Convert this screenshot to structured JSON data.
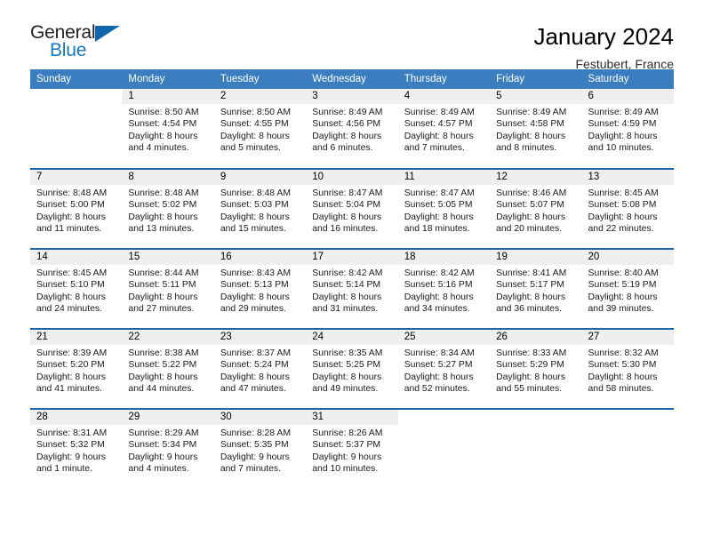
{
  "brand": {
    "name_top": "General",
    "name_bottom": "Blue",
    "triangle_color": "#1166ad",
    "text_color": "#231f20",
    "accent_color": "#1878be"
  },
  "header": {
    "title": "January 2024",
    "subtitle": "Festubert, France"
  },
  "theme": {
    "header_bg": "#3a7ebf",
    "row_divider": "#1f63a8",
    "daynum_bg": "#efefef"
  },
  "weekdays": [
    "Sunday",
    "Monday",
    "Tuesday",
    "Wednesday",
    "Thursday",
    "Friday",
    "Saturday"
  ],
  "weeks": [
    [
      {
        "day": "",
        "lines": []
      },
      {
        "day": "1",
        "lines": [
          "Sunrise: 8:50 AM",
          "Sunset: 4:54 PM",
          "Daylight: 8 hours",
          "and 4 minutes."
        ]
      },
      {
        "day": "2",
        "lines": [
          "Sunrise: 8:50 AM",
          "Sunset: 4:55 PM",
          "Daylight: 8 hours",
          "and 5 minutes."
        ]
      },
      {
        "day": "3",
        "lines": [
          "Sunrise: 8:49 AM",
          "Sunset: 4:56 PM",
          "Daylight: 8 hours",
          "and 6 minutes."
        ]
      },
      {
        "day": "4",
        "lines": [
          "Sunrise: 8:49 AM",
          "Sunset: 4:57 PM",
          "Daylight: 8 hours",
          "and 7 minutes."
        ]
      },
      {
        "day": "5",
        "lines": [
          "Sunrise: 8:49 AM",
          "Sunset: 4:58 PM",
          "Daylight: 8 hours",
          "and 8 minutes."
        ]
      },
      {
        "day": "6",
        "lines": [
          "Sunrise: 8:49 AM",
          "Sunset: 4:59 PM",
          "Daylight: 8 hours",
          "and 10 minutes."
        ]
      }
    ],
    [
      {
        "day": "7",
        "lines": [
          "Sunrise: 8:48 AM",
          "Sunset: 5:00 PM",
          "Daylight: 8 hours",
          "and 11 minutes."
        ]
      },
      {
        "day": "8",
        "lines": [
          "Sunrise: 8:48 AM",
          "Sunset: 5:02 PM",
          "Daylight: 8 hours",
          "and 13 minutes."
        ]
      },
      {
        "day": "9",
        "lines": [
          "Sunrise: 8:48 AM",
          "Sunset: 5:03 PM",
          "Daylight: 8 hours",
          "and 15 minutes."
        ]
      },
      {
        "day": "10",
        "lines": [
          "Sunrise: 8:47 AM",
          "Sunset: 5:04 PM",
          "Daylight: 8 hours",
          "and 16 minutes."
        ]
      },
      {
        "day": "11",
        "lines": [
          "Sunrise: 8:47 AM",
          "Sunset: 5:05 PM",
          "Daylight: 8 hours",
          "and 18 minutes."
        ]
      },
      {
        "day": "12",
        "lines": [
          "Sunrise: 8:46 AM",
          "Sunset: 5:07 PM",
          "Daylight: 8 hours",
          "and 20 minutes."
        ]
      },
      {
        "day": "13",
        "lines": [
          "Sunrise: 8:45 AM",
          "Sunset: 5:08 PM",
          "Daylight: 8 hours",
          "and 22 minutes."
        ]
      }
    ],
    [
      {
        "day": "14",
        "lines": [
          "Sunrise: 8:45 AM",
          "Sunset: 5:10 PM",
          "Daylight: 8 hours",
          "and 24 minutes."
        ]
      },
      {
        "day": "15",
        "lines": [
          "Sunrise: 8:44 AM",
          "Sunset: 5:11 PM",
          "Daylight: 8 hours",
          "and 27 minutes."
        ]
      },
      {
        "day": "16",
        "lines": [
          "Sunrise: 8:43 AM",
          "Sunset: 5:13 PM",
          "Daylight: 8 hours",
          "and 29 minutes."
        ]
      },
      {
        "day": "17",
        "lines": [
          "Sunrise: 8:42 AM",
          "Sunset: 5:14 PM",
          "Daylight: 8 hours",
          "and 31 minutes."
        ]
      },
      {
        "day": "18",
        "lines": [
          "Sunrise: 8:42 AM",
          "Sunset: 5:16 PM",
          "Daylight: 8 hours",
          "and 34 minutes."
        ]
      },
      {
        "day": "19",
        "lines": [
          "Sunrise: 8:41 AM",
          "Sunset: 5:17 PM",
          "Daylight: 8 hours",
          "and 36 minutes."
        ]
      },
      {
        "day": "20",
        "lines": [
          "Sunrise: 8:40 AM",
          "Sunset: 5:19 PM",
          "Daylight: 8 hours",
          "and 39 minutes."
        ]
      }
    ],
    [
      {
        "day": "21",
        "lines": [
          "Sunrise: 8:39 AM",
          "Sunset: 5:20 PM",
          "Daylight: 8 hours",
          "and 41 minutes."
        ]
      },
      {
        "day": "22",
        "lines": [
          "Sunrise: 8:38 AM",
          "Sunset: 5:22 PM",
          "Daylight: 8 hours",
          "and 44 minutes."
        ]
      },
      {
        "day": "23",
        "lines": [
          "Sunrise: 8:37 AM",
          "Sunset: 5:24 PM",
          "Daylight: 8 hours",
          "and 47 minutes."
        ]
      },
      {
        "day": "24",
        "lines": [
          "Sunrise: 8:35 AM",
          "Sunset: 5:25 PM",
          "Daylight: 8 hours",
          "and 49 minutes."
        ]
      },
      {
        "day": "25",
        "lines": [
          "Sunrise: 8:34 AM",
          "Sunset: 5:27 PM",
          "Daylight: 8 hours",
          "and 52 minutes."
        ]
      },
      {
        "day": "26",
        "lines": [
          "Sunrise: 8:33 AM",
          "Sunset: 5:29 PM",
          "Daylight: 8 hours",
          "and 55 minutes."
        ]
      },
      {
        "day": "27",
        "lines": [
          "Sunrise: 8:32 AM",
          "Sunset: 5:30 PM",
          "Daylight: 8 hours",
          "and 58 minutes."
        ]
      }
    ],
    [
      {
        "day": "28",
        "lines": [
          "Sunrise: 8:31 AM",
          "Sunset: 5:32 PM",
          "Daylight: 9 hours",
          "and 1 minute."
        ]
      },
      {
        "day": "29",
        "lines": [
          "Sunrise: 8:29 AM",
          "Sunset: 5:34 PM",
          "Daylight: 9 hours",
          "and 4 minutes."
        ]
      },
      {
        "day": "30",
        "lines": [
          "Sunrise: 8:28 AM",
          "Sunset: 5:35 PM",
          "Daylight: 9 hours",
          "and 7 minutes."
        ]
      },
      {
        "day": "31",
        "lines": [
          "Sunrise: 8:26 AM",
          "Sunset: 5:37 PM",
          "Daylight: 9 hours",
          "and 10 minutes."
        ]
      },
      {
        "day": "",
        "lines": []
      },
      {
        "day": "",
        "lines": []
      },
      {
        "day": "",
        "lines": []
      }
    ]
  ]
}
